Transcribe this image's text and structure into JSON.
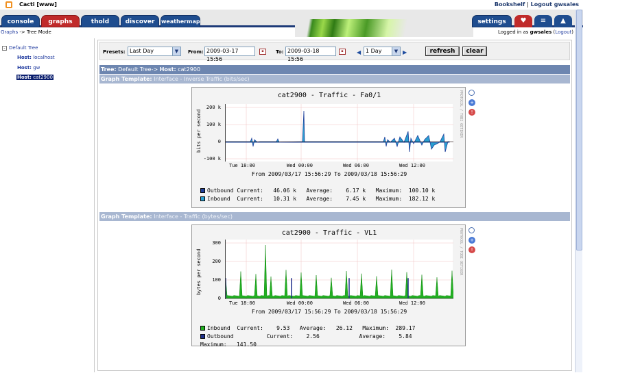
{
  "window": {
    "title": "Cacti [www]"
  },
  "top_links": {
    "bookshelf": "Bookshelf",
    "sep": "|",
    "logout": "Logout gwsales"
  },
  "tabs": {
    "console": "console",
    "graphs": "graphs",
    "thold": "thold",
    "discover": "discover",
    "weathermap": "weathermap",
    "settings": "settings"
  },
  "breadcrumb": {
    "root": "Graphs",
    "arrow": " -> ",
    "current": "Tree Mode"
  },
  "login": {
    "prefix": "Logged in as ",
    "user": "gwsales",
    "open": " (",
    "logout": "Logout",
    "close": ")"
  },
  "tree": {
    "root": "Default Tree",
    "hosts": [
      {
        "prefix": "Host:",
        "name": " localhost",
        "selected": false
      },
      {
        "prefix": "Host:",
        "name": " gw",
        "selected": false
      },
      {
        "prefix": "Host:",
        "name": " cat2900",
        "selected": true
      }
    ]
  },
  "filter": {
    "presets_label": "Presets:",
    "presets_value": "Last Day",
    "from_label": "From:",
    "from_value": "2009-03-17 15:56",
    "to_label": "To:",
    "to_value": "2009-03-18 15:56",
    "shift_value": "1 Day",
    "refresh": "refresh",
    "clear": "clear"
  },
  "tree_header": {
    "tree_label": "Tree:",
    "tree_value": " Default Tree-> ",
    "host_label": "Host:",
    "host_value": " cat2900"
  },
  "graphs": [
    {
      "template_label": "Graph Template:",
      "template_value": " Interface - Inverse Traffic (bits/sec)",
      "title": "cat2900 - Traffic - Fa0/1",
      "ylabel": "bits per second",
      "yticks": [
        "200 k",
        "100 k",
        "0",
        "-100 k"
      ],
      "xticks": [
        "Tue 18:00",
        "Wed 00:00",
        "Wed 06:00",
        "Wed 12:00"
      ],
      "range": "From 2009/03/17 15:56:29 To 2009/03/18 15:56:29",
      "legend": [
        {
          "name": "Outbound",
          "line": " Current:   46.06 k   Average:    6.17 k   Maximum:  100.10 k",
          "color": "#1f3f9a"
        },
        {
          "name": "Inbound",
          "line": "  Current:   10.31 k   Average:    7.45 k   Maximum:  182.12 k",
          "color": "#2a9fd0"
        }
      ],
      "side_text": "PROTOCOL / TOBI OETIKER"
    },
    {
      "template_label": "Graph Template:",
      "template_value": " Interface - Traffic (bytes/sec)",
      "title": "cat2900 - Traffic - VL1",
      "ylabel": "bytes per second",
      "yticks": [
        "300",
        "200",
        "100",
        "0"
      ],
      "xticks": [
        "Tue 18:00",
        "Wed 00:00",
        "Wed 06:00",
        "Wed 12:00"
      ],
      "range": "From 2009/03/17 15:56:29 To 2009/03/18 15:56:29",
      "legend": [
        {
          "name": "Inbound",
          "line": "  Current:    9.53   Average:   26.12   Maximum:  289.17",
          "color": "#22b022"
        },
        {
          "name": "Outbound",
          "line": "          Current:    2.56            Average:    5.84",
          "color": "#1f2f8a"
        }
      ],
      "legend_extra": "Maximum:   141.50",
      "side_text": "PROTOCOL / TOBI OETIKER"
    }
  ],
  "chart_data": [
    {
      "type": "area",
      "title": "cat2900 - Traffic - Fa0/1",
      "ylabel": "bits per second",
      "ylim": [
        -100000,
        200000
      ],
      "x": [
        "Tue 18:00",
        "Wed 00:00",
        "Wed 06:00",
        "Wed 12:00"
      ],
      "series": [
        {
          "name": "Outbound",
          "current": 46060,
          "average": 6170,
          "maximum": 100100
        },
        {
          "name": "Inbound",
          "current": 10310,
          "average": 7450,
          "maximum": 182120
        }
      ]
    },
    {
      "type": "area",
      "title": "cat2900 - Traffic - VL1",
      "ylabel": "bytes per second",
      "ylim": [
        0,
        300
      ],
      "x": [
        "Tue 18:00",
        "Wed 00:00",
        "Wed 06:00",
        "Wed 12:00"
      ],
      "series": [
        {
          "name": "Inbound",
          "current": 9.53,
          "average": 26.12,
          "maximum": 289.17
        },
        {
          "name": "Outbound",
          "current": 2.56,
          "average": 5.84,
          "maximum": 141.5
        }
      ]
    }
  ]
}
